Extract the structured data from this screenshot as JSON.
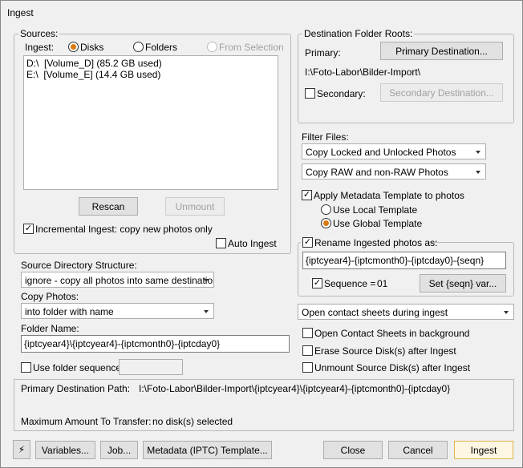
{
  "window": {
    "title": "Ingest"
  },
  "sources": {
    "group_label": "Sources:",
    "ingest_label": "Ingest:",
    "radio_disks": "Disks",
    "radio_folders": "Folders",
    "radio_from_selection": "From Selection",
    "selected_mode": "Disks",
    "disks": [
      "D:\\  [Volume_D] (85.2 GB used)",
      "E:\\  [Volume_E] (14.4 GB used)"
    ],
    "rescan_label": "Rescan",
    "unmount_label": "Unmount",
    "incremental_label": "Incremental Ingest: copy new photos only",
    "incremental_checked": true,
    "auto_ingest_label": "Auto Ingest",
    "auto_ingest_checked": false
  },
  "left": {
    "source_dir_label": "Source Directory Structure:",
    "source_dir_value": "ignore - copy all photos into same destination",
    "copy_photos_label": "Copy Photos:",
    "copy_photos_value": "into folder with name",
    "folder_name_label": "Folder Name:",
    "folder_name_value": "{iptcyear4}\\{iptcyear4}-{iptcmonth0}-{iptcday0}",
    "use_folder_sequence_label": "Use folder sequence",
    "use_folder_sequence_checked": false
  },
  "destination": {
    "group_label": "Destination Folder Roots:",
    "primary_label": "Primary:",
    "primary_button": "Primary Destination...",
    "primary_path": "I:\\Foto-Labor\\Bilder-Import\\",
    "secondary_label": "Secondary:",
    "secondary_checked": false,
    "secondary_button": "Secondary Destination..."
  },
  "filter": {
    "label": "Filter Files:",
    "lock_value": "Copy Locked and Unlocked Photos",
    "raw_value": "Copy RAW and non-RAW Photos",
    "apply_template_label": "Apply Metadata Template to photos",
    "apply_template_checked": true,
    "local_template_label": "Use Local Template",
    "global_template_label": "Use Global Template",
    "template_mode": "global"
  },
  "rename": {
    "label": "Rename Ingested photos as:",
    "checked": true,
    "pattern": "{iptcyear4}-{iptcmonth0}-{iptcday0}-{seqn}",
    "sequence_label": "Sequence =",
    "sequence_checked": true,
    "sequence_value": "01",
    "set_seqn_button": "Set {seqn} var..."
  },
  "contact": {
    "select_value": "Open contact sheets during ingest",
    "background_label": "Open Contact Sheets in background",
    "erase_label": "Erase Source Disk(s) after Ingest",
    "unmount_label": "Unmount Source Disk(s) after Ingest"
  },
  "summary": {
    "primary_path_label": "Primary Destination Path:",
    "primary_path_value": "I:\\Foto-Labor\\Bilder-Import\\{iptcyear4}\\{iptcyear4}-{iptcmonth0}-{iptcday0}",
    "max_transfer_label": "Maximum Amount To Transfer:",
    "max_transfer_value": "no disk(s) selected"
  },
  "buttons": {
    "lightning": "⚡",
    "variables": "Variables...",
    "job": "Job...",
    "metadata": "Metadata (IPTC) Template...",
    "close": "Close",
    "cancel": "Cancel",
    "ingest": "Ingest"
  },
  "colors": {
    "accent": "#d97a10",
    "default_button_border": "#e0b44c"
  }
}
